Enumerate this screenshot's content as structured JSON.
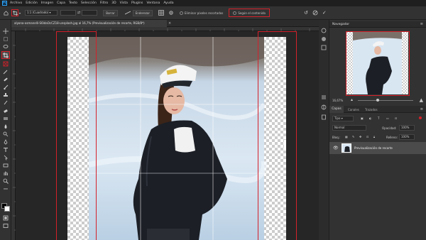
{
  "app": {
    "logo": "Ps"
  },
  "menu": [
    "Archivo",
    "Edición",
    "Imagen",
    "Capa",
    "Texto",
    "Selección",
    "Filtro",
    "3D",
    "Vista",
    "Plugins",
    "Ventana",
    "Ayuda"
  ],
  "options": {
    "ratio": "1:1 (Cuadrado)",
    "clear_label": "Borrar",
    "straighten_label": "Enderezar",
    "delete_cropped_label": "Eliminar píxeles recortados",
    "content_aware_label": "Según el contenido"
  },
  "document": {
    "tab_title": "alyona-osmanelli-S6ldaOcCZ18-unsplash.jpg al 16,7% (Previsualización de recorte, RGB/8*)",
    "close": "×"
  },
  "navigator": {
    "title": "Navegador",
    "zoom": "16,67%"
  },
  "layers_panel": {
    "tabs": [
      "Capas",
      "Canales",
      "Trazados"
    ],
    "filter_kind": "Tipo",
    "blend_mode": "Normal",
    "opacity_label": "Opacidad:",
    "opacity_value": "100%",
    "lock_label": "Bloq.:",
    "fill_label": "Relleno:",
    "fill_value": "100%",
    "layer_name": "Previsualización de recorte"
  },
  "colors": {
    "highlight": "#d4212a",
    "accent": "#31a8ff"
  }
}
